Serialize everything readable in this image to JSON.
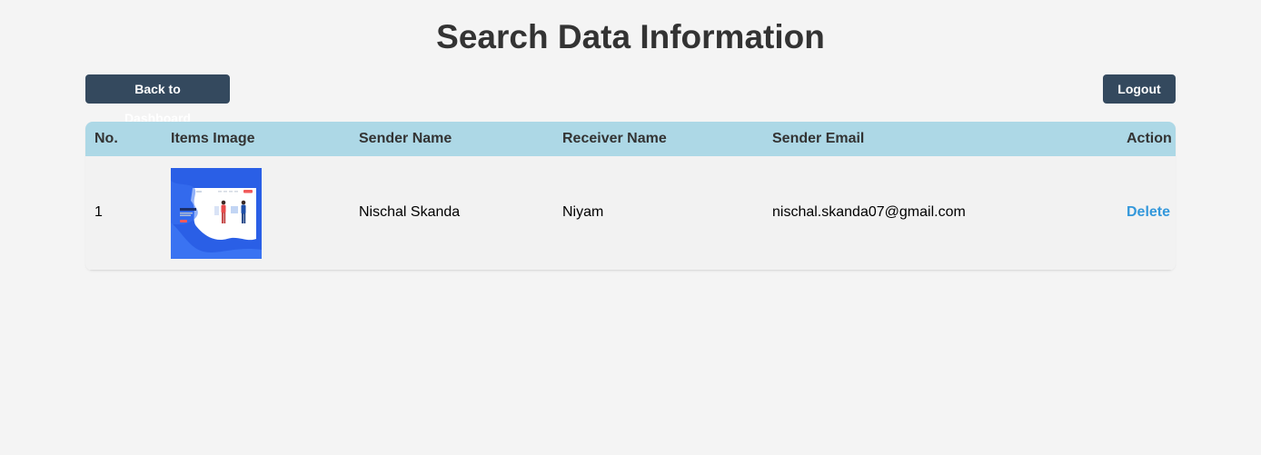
{
  "header": {
    "title": "Search Data Information"
  },
  "toolbar": {
    "back_label": "Back to Dashboard",
    "logout_label": "Logout"
  },
  "table": {
    "columns": [
      "No.",
      "Items Image",
      "Sender Name",
      "Receiver Name",
      "Sender Email",
      "Action"
    ],
    "rows": [
      {
        "no": "1",
        "image_icon": "item-thumbnail-image",
        "sender_name": "Nischal Skanda",
        "receiver_name": "Niyam",
        "sender_email": "nischal.skanda07@gmail.com",
        "action": "Delete"
      }
    ]
  },
  "colors": {
    "background": "#f4f4f4",
    "header_bg": "#add8e6",
    "button_bg": "#34495e",
    "link": "#3498db"
  }
}
